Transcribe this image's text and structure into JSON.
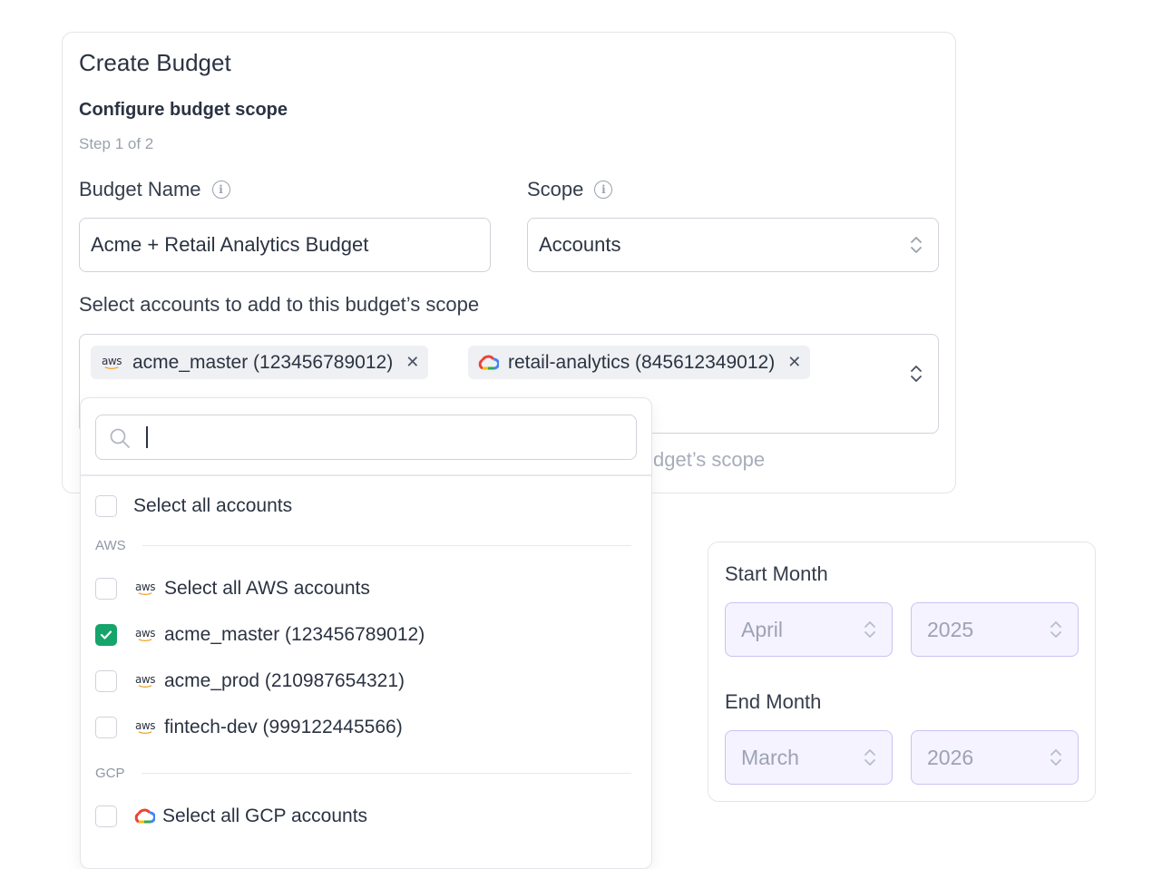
{
  "header": {
    "title": "Create Budget",
    "subtitle": "Configure budget scope",
    "step": "Step 1 of 2"
  },
  "budget_name": {
    "label": "Budget Name",
    "value": "Acme + Retail Analytics Budget"
  },
  "scope": {
    "label": "Scope",
    "value": "Accounts"
  },
  "accounts": {
    "label": "Select accounts to add to this budget’s scope",
    "chips": [
      {
        "label": "acme_master (123456789012)",
        "provider": "aws"
      },
      {
        "label": "retail-analytics (845612349012)",
        "provider": "gcp"
      }
    ],
    "ghost_text": "dget’s scope"
  },
  "dropdown": {
    "search_value": "",
    "select_all": "Select all accounts",
    "aws_group": "AWS",
    "aws_items": [
      {
        "label": "Select all AWS accounts",
        "checked": false
      },
      {
        "label": "acme_master (123456789012)",
        "checked": true
      },
      {
        "label": "acme_prod (210987654321)",
        "checked": false
      },
      {
        "label": "fintech-dev (999122445566)",
        "checked": false
      }
    ],
    "gcp_group": "GCP",
    "gcp_items": [
      {
        "label": "Select all GCP accounts",
        "checked": false
      }
    ]
  },
  "period": {
    "start_label": "Start Month",
    "start_month": "April",
    "start_year": "2025",
    "end_label": "End Month",
    "end_month": "March",
    "end_year": "2026"
  },
  "icons": {
    "aws_text": "aws",
    "remove": "✕",
    "info": "i"
  },
  "colors": {
    "check": "#15a46a",
    "aws_smile": "#f0a020",
    "month_field_bg": "#f4f3ff",
    "month_field_border": "#c9c3f2"
  }
}
